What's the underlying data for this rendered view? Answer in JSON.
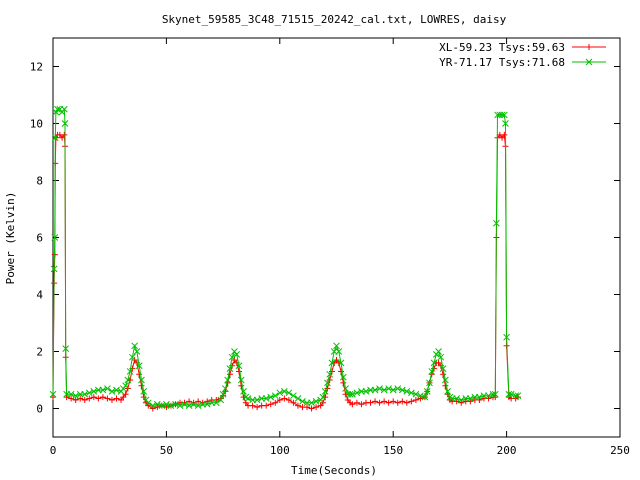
{
  "chart_data": {
    "type": "line",
    "title": "Skynet_59585_3C48_71515_20242_cal.txt, LOWRES, daisy",
    "xlabel": "Time(Seconds)",
    "ylabel": "Power (Kelvin)",
    "xlim": [
      0,
      250
    ],
    "ylim": [
      -1,
      13
    ],
    "xticks": [
      0,
      50,
      100,
      150,
      200,
      250
    ],
    "yticks": [
      0,
      2,
      4,
      6,
      8,
      10,
      12
    ],
    "x_tick_labels": [
      "0",
      "50",
      "100",
      "150",
      "200",
      "250"
    ],
    "y_tick_labels": [
      "0",
      "2",
      "4",
      "6",
      "8",
      "10",
      "12"
    ],
    "grid": false,
    "legend_position": "top-right",
    "series": [
      {
        "name": "XL-59.23 Tsys:59.63",
        "color": "#ff0000",
        "marker": "plus",
        "points": [
          [
            0,
            0.4
          ],
          [
            0.5,
            4.4
          ],
          [
            0.8,
            5.4
          ],
          [
            1.0,
            8.6
          ],
          [
            1.3,
            9.5
          ],
          [
            2,
            9.6
          ],
          [
            3,
            9.6
          ],
          [
            4,
            9.5
          ],
          [
            5,
            9.6
          ],
          [
            5.3,
            9.2
          ],
          [
            5.6,
            1.8
          ],
          [
            6,
            0.4
          ],
          [
            8,
            0.35
          ],
          [
            10,
            0.3
          ],
          [
            12,
            0.35
          ],
          [
            14,
            0.3
          ],
          [
            16,
            0.35
          ],
          [
            18,
            0.4
          ],
          [
            20,
            0.35
          ],
          [
            22,
            0.4
          ],
          [
            24,
            0.35
          ],
          [
            26,
            0.3
          ],
          [
            28,
            0.35
          ],
          [
            30,
            0.3
          ],
          [
            31,
            0.4
          ],
          [
            32,
            0.5
          ],
          [
            33,
            0.7
          ],
          [
            34,
            1.0
          ],
          [
            35,
            1.4
          ],
          [
            36,
            1.7
          ],
          [
            37,
            1.6
          ],
          [
            38,
            1.2
          ],
          [
            39,
            0.8
          ],
          [
            40,
            0.4
          ],
          [
            41,
            0.2
          ],
          [
            42,
            0.1
          ],
          [
            44,
            0.0
          ],
          [
            46,
            0.05
          ],
          [
            48,
            0.1
          ],
          [
            50,
            0.05
          ],
          [
            52,
            0.1
          ],
          [
            54,
            0.15
          ],
          [
            56,
            0.2
          ],
          [
            58,
            0.2
          ],
          [
            60,
            0.25
          ],
          [
            62,
            0.2
          ],
          [
            64,
            0.25
          ],
          [
            66,
            0.2
          ],
          [
            68,
            0.25
          ],
          [
            70,
            0.3
          ],
          [
            72,
            0.3
          ],
          [
            74,
            0.35
          ],
          [
            75,
            0.45
          ],
          [
            76,
            0.6
          ],
          [
            77,
            0.9
          ],
          [
            78,
            1.2
          ],
          [
            79,
            1.5
          ],
          [
            80,
            1.7
          ],
          [
            81,
            1.6
          ],
          [
            82,
            1.3
          ],
          [
            83,
            0.8
          ],
          [
            84,
            0.4
          ],
          [
            85,
            0.2
          ],
          [
            86,
            0.1
          ],
          [
            88,
            0.1
          ],
          [
            90,
            0.05
          ],
          [
            92,
            0.1
          ],
          [
            94,
            0.1
          ],
          [
            96,
            0.15
          ],
          [
            98,
            0.2
          ],
          [
            100,
            0.3
          ],
          [
            102,
            0.35
          ],
          [
            104,
            0.3
          ],
          [
            106,
            0.2
          ],
          [
            108,
            0.1
          ],
          [
            110,
            0.05
          ],
          [
            112,
            0.05
          ],
          [
            114,
            0.0
          ],
          [
            116,
            0.05
          ],
          [
            118,
            0.1
          ],
          [
            119,
            0.2
          ],
          [
            120,
            0.4
          ],
          [
            121,
            0.7
          ],
          [
            122,
            1.0
          ],
          [
            123,
            1.3
          ],
          [
            124,
            1.6
          ],
          [
            125,
            1.7
          ],
          [
            126,
            1.6
          ],
          [
            127,
            1.3
          ],
          [
            128,
            0.9
          ],
          [
            129,
            0.5
          ],
          [
            130,
            0.3
          ],
          [
            131,
            0.2
          ],
          [
            132,
            0.15
          ],
          [
            134,
            0.2
          ],
          [
            136,
            0.15
          ],
          [
            138,
            0.2
          ],
          [
            140,
            0.2
          ],
          [
            142,
            0.25
          ],
          [
            144,
            0.2
          ],
          [
            146,
            0.25
          ],
          [
            148,
            0.2
          ],
          [
            150,
            0.25
          ],
          [
            152,
            0.2
          ],
          [
            154,
            0.25
          ],
          [
            156,
            0.2
          ],
          [
            158,
            0.25
          ],
          [
            160,
            0.3
          ],
          [
            162,
            0.35
          ],
          [
            164,
            0.4
          ],
          [
            165,
            0.6
          ],
          [
            166,
            0.9
          ],
          [
            167,
            1.2
          ],
          [
            168,
            1.4
          ],
          [
            169,
            1.6
          ],
          [
            170,
            1.6
          ],
          [
            171,
            1.5
          ],
          [
            172,
            1.2
          ],
          [
            173,
            0.8
          ],
          [
            174,
            0.5
          ],
          [
            175,
            0.3
          ],
          [
            176,
            0.25
          ],
          [
            178,
            0.25
          ],
          [
            180,
            0.2
          ],
          [
            182,
            0.25
          ],
          [
            184,
            0.25
          ],
          [
            186,
            0.3
          ],
          [
            188,
            0.3
          ],
          [
            190,
            0.35
          ],
          [
            192,
            0.35
          ],
          [
            194,
            0.4
          ],
          [
            195,
            0.4
          ],
          [
            195.5,
            6.0
          ],
          [
            196,
            9.5
          ],
          [
            197,
            9.6
          ],
          [
            198,
            9.5
          ],
          [
            199,
            9.6
          ],
          [
            199.5,
            9.2
          ],
          [
            200,
            2.2
          ],
          [
            201,
            0.4
          ],
          [
            202,
            0.35
          ],
          [
            204,
            0.35
          ],
          [
            205,
            0.4
          ]
        ]
      },
      {
        "name": "YR-71.17 Tsys:71.68",
        "color": "#00c000",
        "marker": "x",
        "points": [
          [
            0,
            0.5
          ],
          [
            0.5,
            4.9
          ],
          [
            0.8,
            6.0
          ],
          [
            1.0,
            9.5
          ],
          [
            1.3,
            10.4
          ],
          [
            2,
            10.5
          ],
          [
            3,
            10.5
          ],
          [
            4,
            10.4
          ],
          [
            5,
            10.5
          ],
          [
            5.3,
            10.0
          ],
          [
            5.6,
            2.1
          ],
          [
            6,
            0.5
          ],
          [
            8,
            0.5
          ],
          [
            10,
            0.45
          ],
          [
            12,
            0.5
          ],
          [
            14,
            0.5
          ],
          [
            16,
            0.55
          ],
          [
            18,
            0.6
          ],
          [
            20,
            0.65
          ],
          [
            22,
            0.65
          ],
          [
            24,
            0.7
          ],
          [
            26,
            0.6
          ],
          [
            28,
            0.65
          ],
          [
            30,
            0.6
          ],
          [
            31,
            0.7
          ],
          [
            32,
            0.8
          ],
          [
            33,
            1.0
          ],
          [
            34,
            1.3
          ],
          [
            35,
            1.8
          ],
          [
            36,
            2.2
          ],
          [
            37,
            2.0
          ],
          [
            38,
            1.5
          ],
          [
            39,
            1.0
          ],
          [
            40,
            0.6
          ],
          [
            41,
            0.3
          ],
          [
            42,
            0.2
          ],
          [
            44,
            0.1
          ],
          [
            46,
            0.15
          ],
          [
            48,
            0.1
          ],
          [
            50,
            0.15
          ],
          [
            52,
            0.1
          ],
          [
            54,
            0.15
          ],
          [
            56,
            0.1
          ],
          [
            58,
            0.15
          ],
          [
            60,
            0.1
          ],
          [
            62,
            0.15
          ],
          [
            64,
            0.1
          ],
          [
            66,
            0.15
          ],
          [
            68,
            0.15
          ],
          [
            70,
            0.2
          ],
          [
            72,
            0.2
          ],
          [
            74,
            0.3
          ],
          [
            75,
            0.5
          ],
          [
            76,
            0.7
          ],
          [
            77,
            1.0
          ],
          [
            78,
            1.4
          ],
          [
            79,
            1.8
          ],
          [
            80,
            2.0
          ],
          [
            81,
            1.9
          ],
          [
            82,
            1.5
          ],
          [
            83,
            1.0
          ],
          [
            84,
            0.6
          ],
          [
            85,
            0.4
          ],
          [
            86,
            0.35
          ],
          [
            88,
            0.3
          ],
          [
            90,
            0.3
          ],
          [
            92,
            0.35
          ],
          [
            94,
            0.35
          ],
          [
            96,
            0.4
          ],
          [
            98,
            0.45
          ],
          [
            100,
            0.55
          ],
          [
            102,
            0.6
          ],
          [
            104,
            0.55
          ],
          [
            106,
            0.45
          ],
          [
            108,
            0.35
          ],
          [
            110,
            0.25
          ],
          [
            112,
            0.2
          ],
          [
            114,
            0.2
          ],
          [
            116,
            0.25
          ],
          [
            118,
            0.3
          ],
          [
            119,
            0.4
          ],
          [
            120,
            0.6
          ],
          [
            121,
            0.9
          ],
          [
            122,
            1.2
          ],
          [
            123,
            1.6
          ],
          [
            124,
            2.0
          ],
          [
            125,
            2.2
          ],
          [
            126,
            2.0
          ],
          [
            127,
            1.6
          ],
          [
            128,
            1.1
          ],
          [
            129,
            0.7
          ],
          [
            130,
            0.5
          ],
          [
            131,
            0.5
          ],
          [
            132,
            0.5
          ],
          [
            134,
            0.55
          ],
          [
            136,
            0.6
          ],
          [
            138,
            0.6
          ],
          [
            140,
            0.65
          ],
          [
            142,
            0.65
          ],
          [
            144,
            0.7
          ],
          [
            146,
            0.65
          ],
          [
            148,
            0.7
          ],
          [
            150,
            0.65
          ],
          [
            152,
            0.7
          ],
          [
            154,
            0.65
          ],
          [
            156,
            0.6
          ],
          [
            158,
            0.55
          ],
          [
            160,
            0.5
          ],
          [
            162,
            0.45
          ],
          [
            164,
            0.4
          ],
          [
            165,
            0.6
          ],
          [
            166,
            0.9
          ],
          [
            167,
            1.3
          ],
          [
            168,
            1.6
          ],
          [
            169,
            1.9
          ],
          [
            170,
            2.0
          ],
          [
            171,
            1.8
          ],
          [
            172,
            1.4
          ],
          [
            173,
            1.0
          ],
          [
            174,
            0.6
          ],
          [
            175,
            0.4
          ],
          [
            176,
            0.35
          ],
          [
            178,
            0.35
          ],
          [
            180,
            0.3
          ],
          [
            182,
            0.35
          ],
          [
            184,
            0.35
          ],
          [
            186,
            0.4
          ],
          [
            188,
            0.4
          ],
          [
            190,
            0.45
          ],
          [
            192,
            0.45
          ],
          [
            194,
            0.5
          ],
          [
            195,
            0.5
          ],
          [
            195.5,
            6.5
          ],
          [
            196,
            10.3
          ],
          [
            197,
            10.3
          ],
          [
            198,
            10.3
          ],
          [
            199,
            10.3
          ],
          [
            199.5,
            10.0
          ],
          [
            200,
            2.5
          ],
          [
            201,
            0.5
          ],
          [
            202,
            0.5
          ],
          [
            204,
            0.45
          ],
          [
            205,
            0.45
          ]
        ]
      }
    ]
  }
}
